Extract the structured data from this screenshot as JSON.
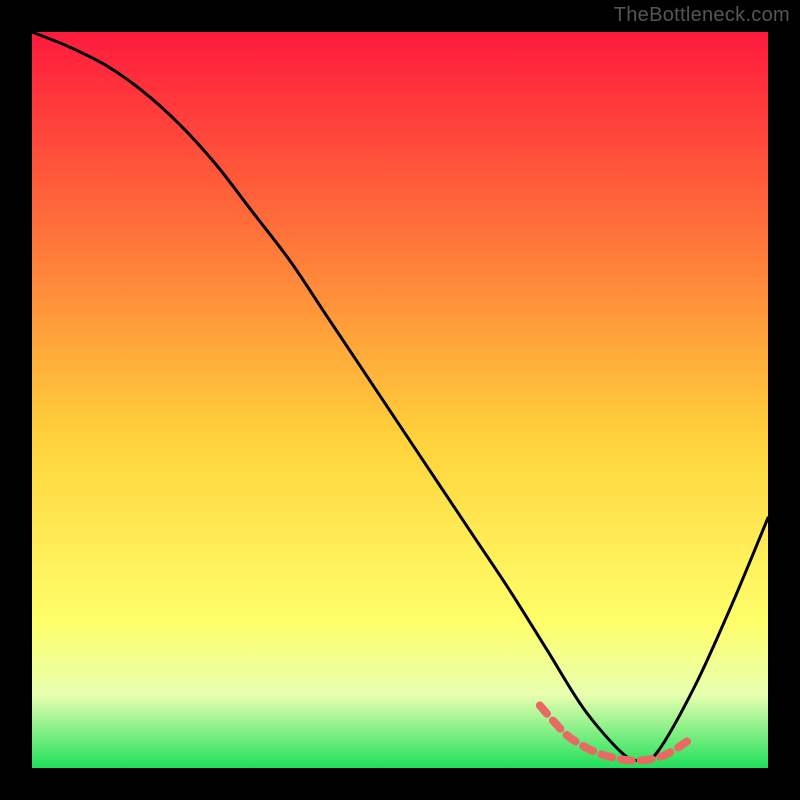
{
  "watermark": "TheBottleneck.com",
  "colors": {
    "bg": "#000000",
    "gradient_top": "#ff1a3c",
    "gradient_mid1": "#ff6a3a",
    "gradient_mid2": "#ffd23a",
    "gradient_mid3": "#ffff6a",
    "gradient_bottom": "#1fe05a",
    "curve": "#000000",
    "coral": "#e86a63"
  },
  "chart_data": {
    "type": "line",
    "title": "",
    "xlabel": "",
    "ylabel": "",
    "xlim": [
      0,
      100
    ],
    "ylim": [
      0,
      100
    ],
    "series": [
      {
        "name": "main-curve",
        "x": [
          0,
          5,
          10,
          15,
          20,
          25,
          30,
          35,
          40,
          45,
          50,
          55,
          60,
          65,
          70,
          75,
          80,
          82.5,
          85,
          90,
          95,
          100
        ],
        "y": [
          100,
          98,
          95.5,
          92,
          87.5,
          82,
          75.5,
          69,
          61.5,
          54,
          46.5,
          39,
          31.5,
          24,
          16,
          8,
          2.2,
          1,
          2.2,
          11,
          22,
          34
        ]
      },
      {
        "name": "coral-highlight",
        "x": [
          69,
          71,
          73,
          76,
          79,
          82,
          85,
          87,
          89
        ],
        "y": [
          8.5,
          6.2,
          4.2,
          2.4,
          1.4,
          1,
          1.4,
          2.3,
          3.6
        ]
      }
    ]
  }
}
